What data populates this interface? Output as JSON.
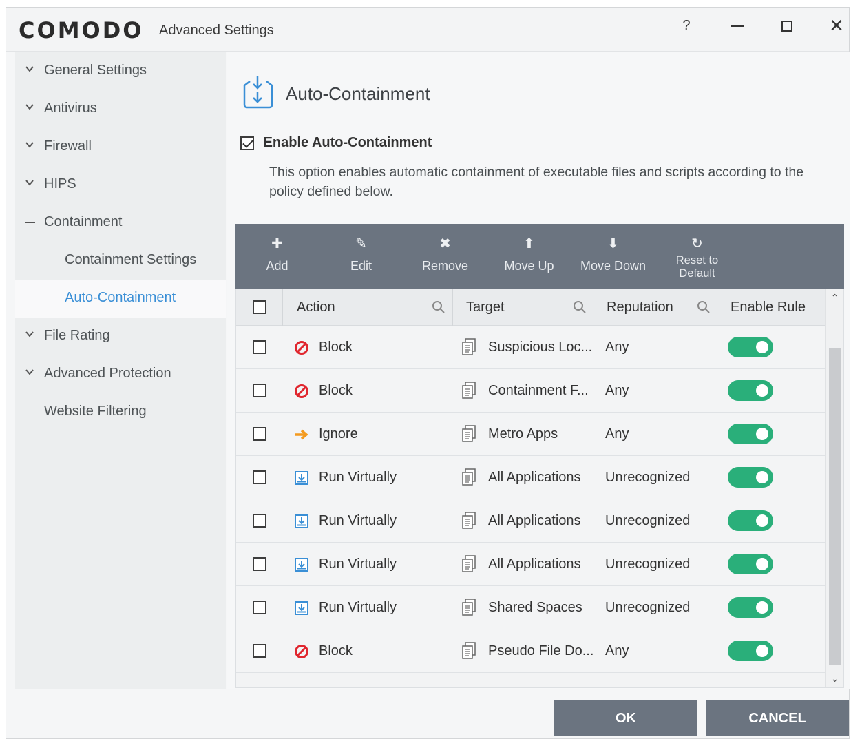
{
  "window": {
    "logo": "COMODO",
    "title": "Advanced Settings",
    "help_label": "?",
    "close_label": "✕"
  },
  "sidebar": {
    "items": [
      {
        "label": "General Settings"
      },
      {
        "label": "Antivirus"
      },
      {
        "label": "Firewall"
      },
      {
        "label": "HIPS"
      },
      {
        "label": "Containment"
      },
      {
        "label": "Containment Settings"
      },
      {
        "label": "Auto-Containment"
      },
      {
        "label": "File Rating"
      },
      {
        "label": "Advanced Protection"
      },
      {
        "label": "Website Filtering"
      }
    ]
  },
  "main": {
    "section_title": "Auto-Containment",
    "enable_label": "Enable Auto-Containment",
    "enable_checked": true,
    "description": "This option enables automatic containment of executable files and scripts according to the policy defined below."
  },
  "toolbar": {
    "add": "Add",
    "edit": "Edit",
    "remove": "Remove",
    "move_up": "Move Up",
    "move_down": "Move Down",
    "reset_line1": "Reset to",
    "reset_line2": "Default"
  },
  "table": {
    "headers": {
      "action": "Action",
      "target": "Target",
      "reputation": "Reputation",
      "enable_rule": "Enable Rule"
    },
    "rows": [
      {
        "action": "Block",
        "action_icon": "block-icon",
        "target": "Suspicious Loc...",
        "reputation": "Any",
        "enabled": true
      },
      {
        "action": "Block",
        "action_icon": "block-icon",
        "target": "Containment F...",
        "reputation": "Any",
        "enabled": true
      },
      {
        "action": "Ignore",
        "action_icon": "arrow-right-icon",
        "target": "Metro Apps",
        "reputation": "Any",
        "enabled": true
      },
      {
        "action": "Run Virtually",
        "action_icon": "run-virtually-icon",
        "target": "All Applications",
        "reputation": "Unrecognized",
        "enabled": true
      },
      {
        "action": "Run Virtually",
        "action_icon": "run-virtually-icon",
        "target": "All Applications",
        "reputation": "Unrecognized",
        "enabled": true
      },
      {
        "action": "Run Virtually",
        "action_icon": "run-virtually-icon",
        "target": "All Applications",
        "reputation": "Unrecognized",
        "enabled": true
      },
      {
        "action": "Run Virtually",
        "action_icon": "run-virtually-icon",
        "target": "Shared Spaces",
        "reputation": "Unrecognized",
        "enabled": true
      },
      {
        "action": "Block",
        "action_icon": "block-icon",
        "target": "Pseudo File Do...",
        "reputation": "Any",
        "enabled": true
      }
    ]
  },
  "footer": {
    "ok": "OK",
    "cancel": "CANCEL"
  },
  "colors": {
    "accent": "#3a8fd6",
    "toolbar": "#6b7480",
    "toggle_on": "#2aaf7a",
    "block_red": "#e0262e",
    "ignore_orange": "#f39a1e"
  }
}
